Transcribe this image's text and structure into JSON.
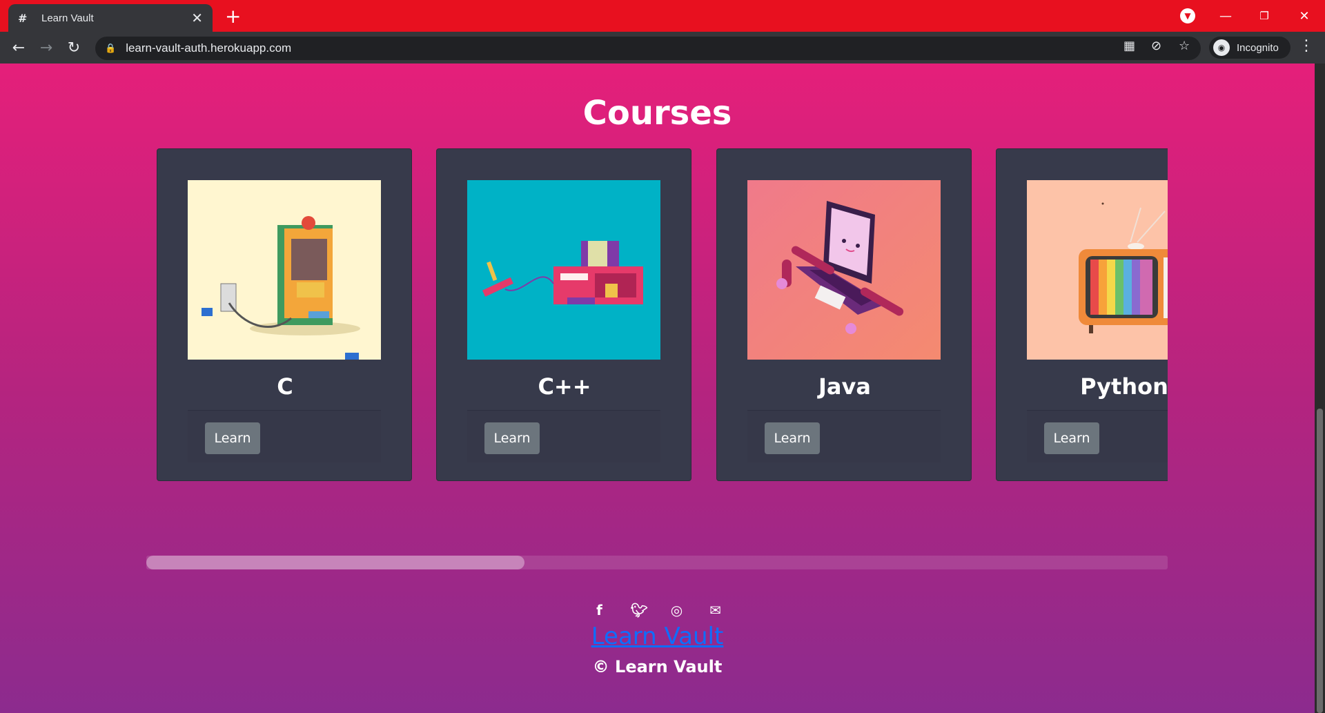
{
  "browser": {
    "tab_title": "Learn Vault",
    "tab_favicon": "#",
    "new_tab": "+",
    "url": "learn-vault-auth.herokuapp.com",
    "profile_label": "Incognito",
    "window_controls": {
      "minimize": "—",
      "restore": "❐",
      "close": "✕"
    },
    "colors": {
      "tabbar": "#e8101f",
      "toolbar": "#35363a"
    }
  },
  "page": {
    "heading": "Courses",
    "courses": [
      {
        "title": "C",
        "button": "Learn",
        "art": "arcade-machine-illustration"
      },
      {
        "title": "C++",
        "button": "Learn",
        "art": "retro-console-illustration"
      },
      {
        "title": "Java",
        "button": "Learn",
        "art": "laptop-character-illustration"
      },
      {
        "title": "Python",
        "button": "Learn",
        "art": "retro-tv-illustration"
      }
    ],
    "carousel_scroll_fraction": 0.37
  },
  "footer": {
    "social_icons": [
      "facebook-icon",
      "twitter-icon",
      "instagram-icon",
      "email-icon"
    ],
    "brand_link": "Learn Vault",
    "copyright": "© Learn Vault"
  }
}
